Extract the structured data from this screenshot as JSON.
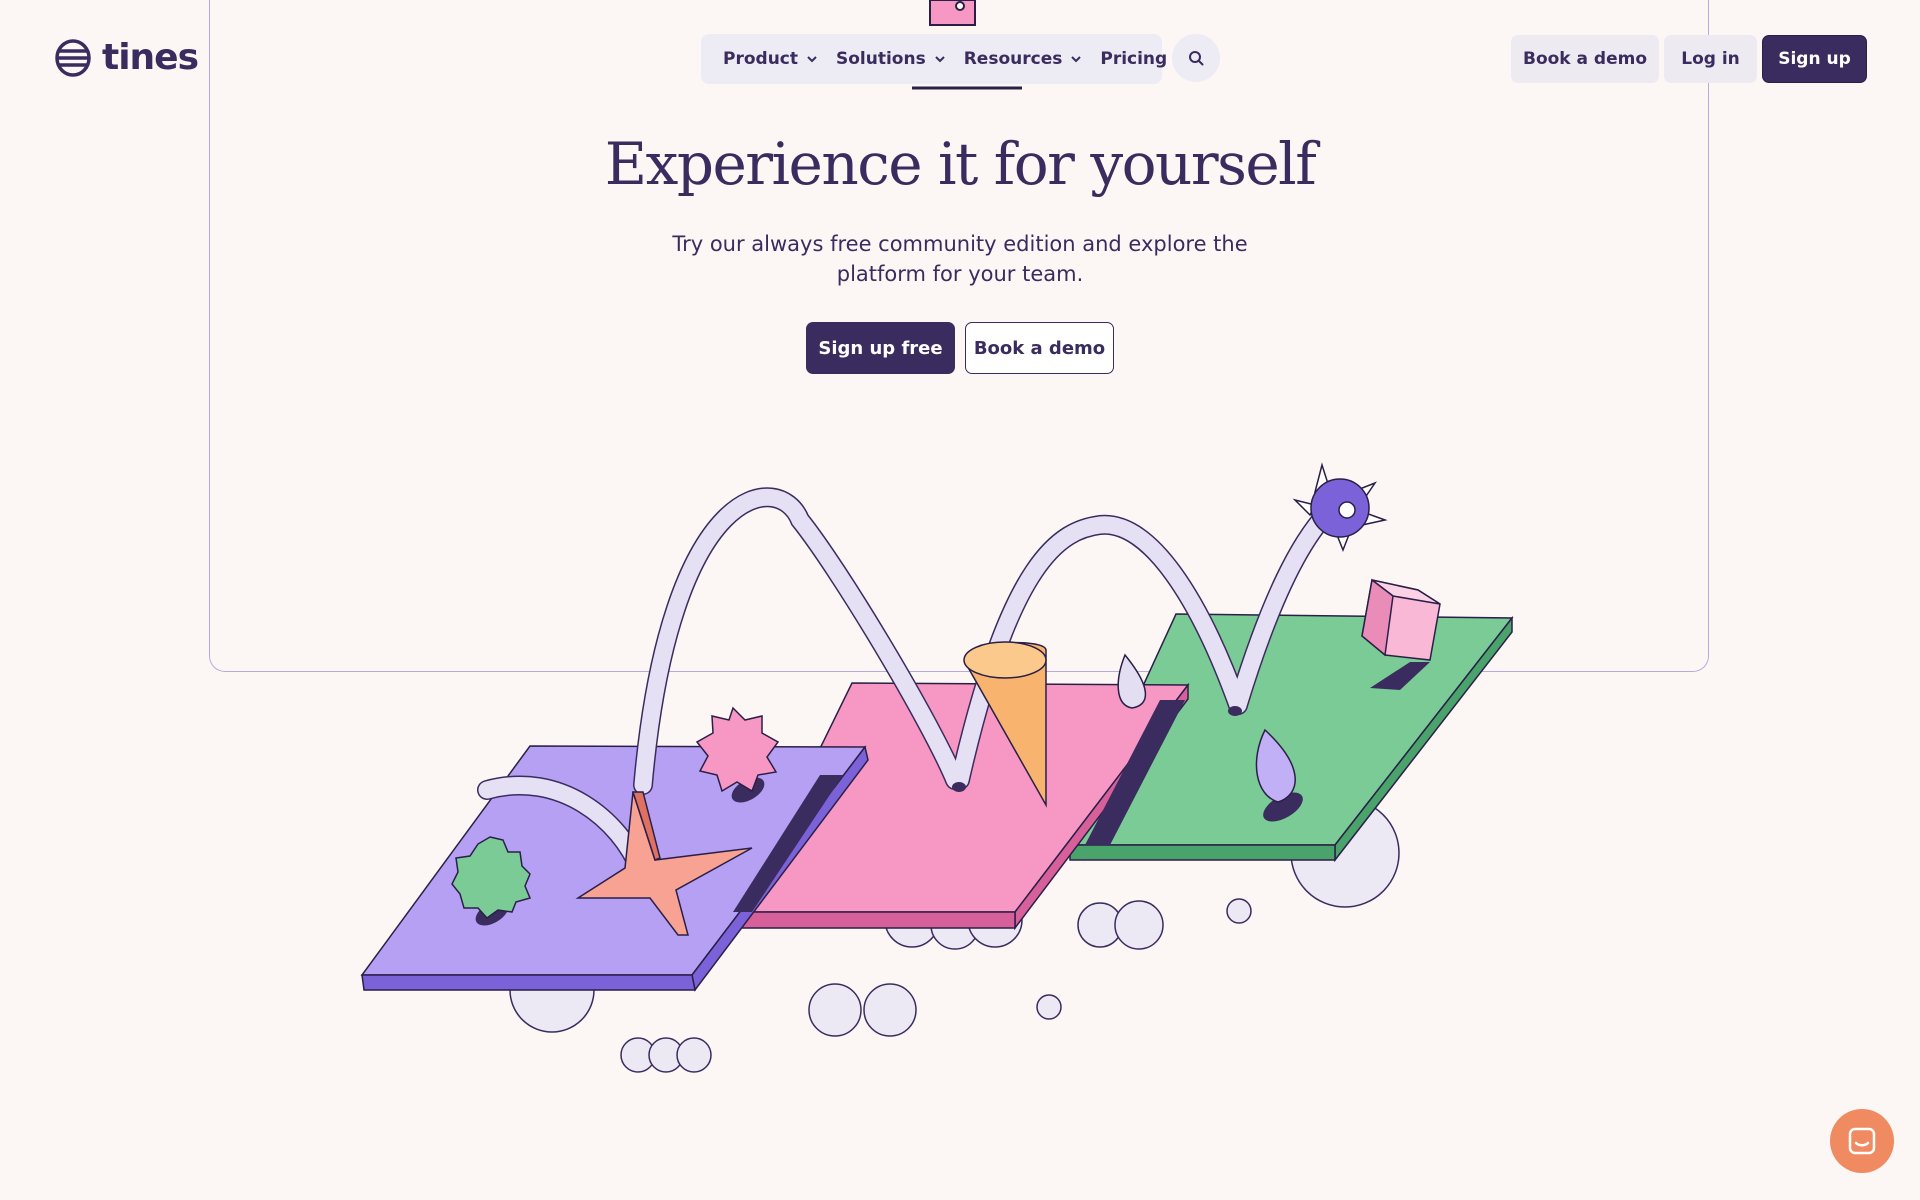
{
  "brand": {
    "name": "tines"
  },
  "nav": {
    "items": [
      {
        "label": "Product",
        "has_menu": true
      },
      {
        "label": "Solutions",
        "has_menu": true
      },
      {
        "label": "Resources",
        "has_menu": true
      },
      {
        "label": "Pricing",
        "has_menu": false
      }
    ],
    "search_icon": "search-icon"
  },
  "header_actions": {
    "book_demo": "Book a demo",
    "log_in": "Log in",
    "sign_up": "Sign up"
  },
  "hero": {
    "title": "Experience it for yourself",
    "subtitle": "Try our always free community edition and explore the platform for your team.",
    "primary_cta": "Sign up free",
    "secondary_cta": "Book a demo"
  },
  "chat": {
    "icon": "chat-icon"
  },
  "colors": {
    "background": "#fcf7f4",
    "ink": "#3a2c5e",
    "purple_tile": "#b6a0f4",
    "pink_tile": "#f698c3",
    "green_tile": "#7acb95",
    "chat_button": "#f08a61"
  }
}
